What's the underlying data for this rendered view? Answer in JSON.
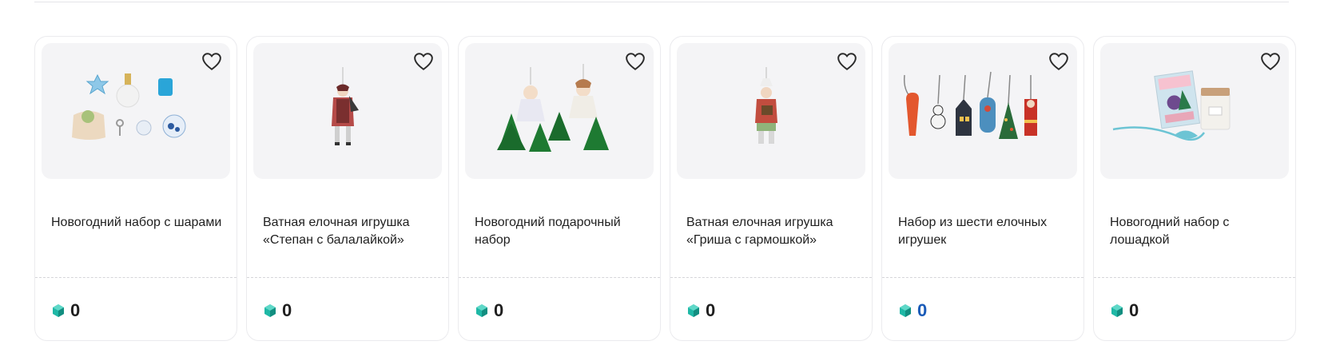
{
  "products": [
    {
      "title": "Новогодний набор с шарами",
      "price": "0",
      "image": "gift-set-with-balls"
    },
    {
      "title": "Ватная елочная игрушка «Степан с балалайкой»",
      "price": "0",
      "image": "cotton-toy-stepan"
    },
    {
      "title": "Новогодний подарочный набор",
      "price": "0",
      "image": "angels-and-trees"
    },
    {
      "title": "Ватная елочная игрушка «Гриша с гармошкой»",
      "price": "0",
      "image": "cotton-toy-grisha"
    },
    {
      "title": "Набор из шести елочных игрушек",
      "price": "0",
      "image": "six-ornaments"
    },
    {
      "title": "Новогодний набор с лошадкой",
      "price": "0",
      "image": "set-with-horse"
    }
  ],
  "icons": {
    "favorite": "heart-outline-icon",
    "currency": "green-gem-icon"
  },
  "colors": {
    "gem": "#1fb8a6",
    "price_highlight": "#1a5bb8",
    "image_bg": "#f4f4f6"
  }
}
